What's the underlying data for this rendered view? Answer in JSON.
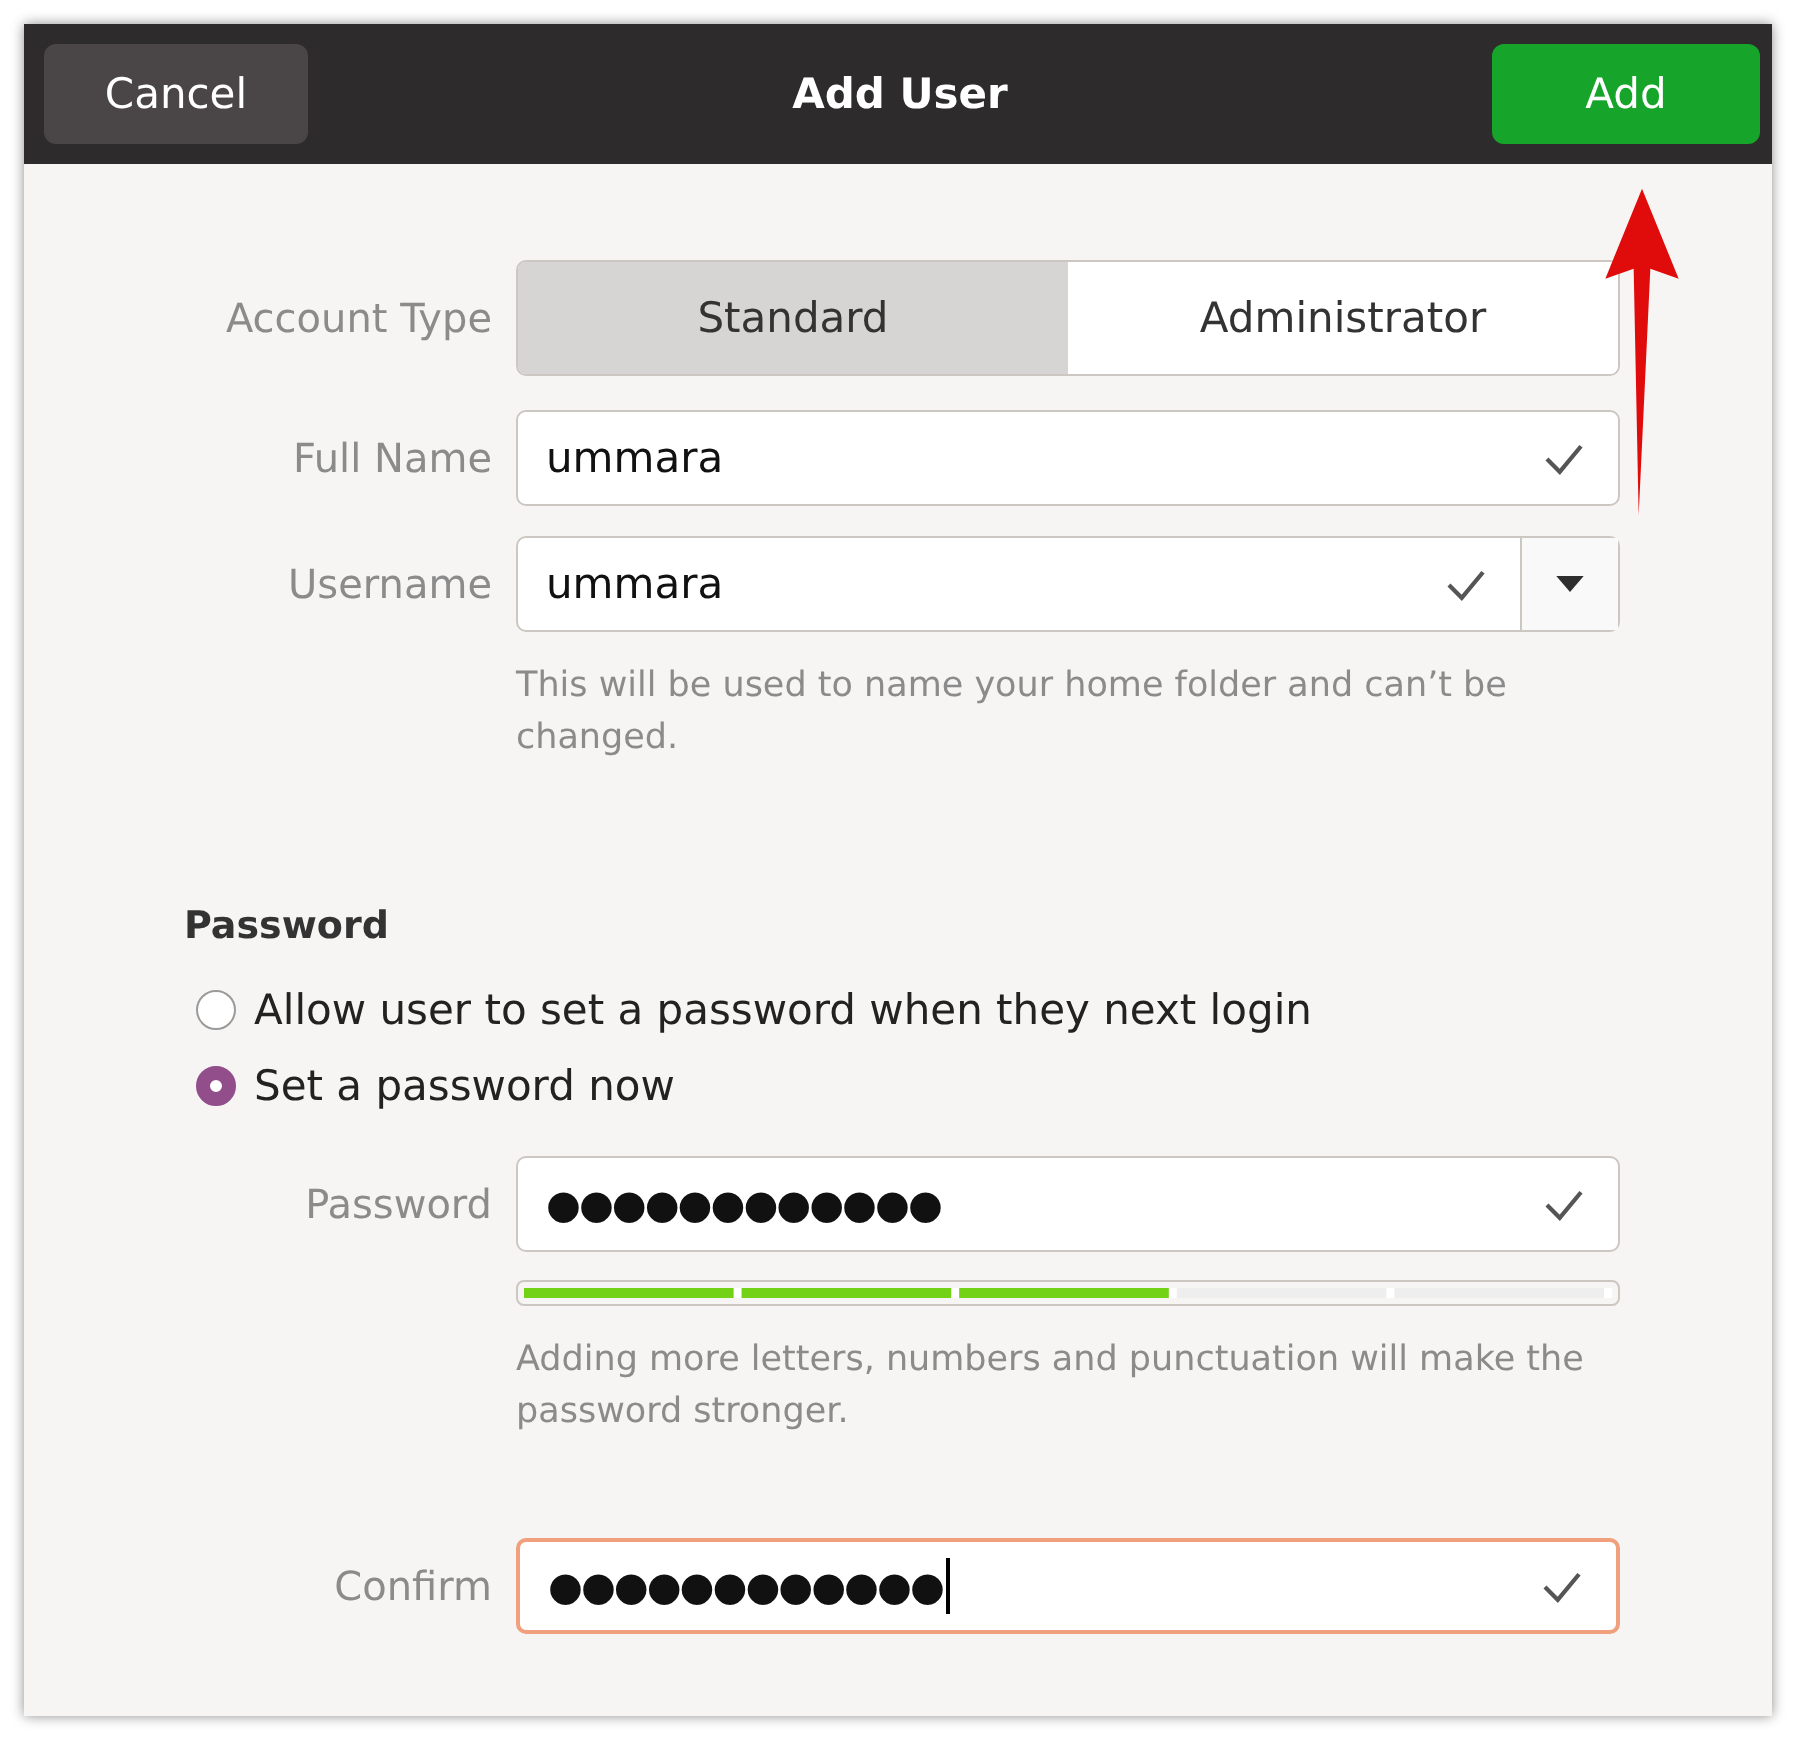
{
  "header": {
    "cancel": "Cancel",
    "title": "Add User",
    "add": "Add"
  },
  "account_type": {
    "label": "Account Type",
    "options": [
      {
        "label": "Standard",
        "selected": true
      },
      {
        "label": "Administrator",
        "selected": false
      }
    ]
  },
  "full_name": {
    "label": "Full Name",
    "value": "ummara",
    "valid": true
  },
  "username": {
    "label": "Username",
    "value": "ummara",
    "valid": true,
    "hint": "This will be used to name your home folder and can’t be changed."
  },
  "password_section": {
    "heading": "Password",
    "options": [
      {
        "label": "Allow user to set a password when they next login",
        "selected": false
      },
      {
        "label": "Set a password now",
        "selected": true
      }
    ]
  },
  "password": {
    "label": "Password",
    "value": "●●●●●●●●●●●●",
    "valid": true,
    "focused": false
  },
  "strength": {
    "level": 0.6,
    "hint": "Adding more letters, numbers and punctuation will make the password stronger."
  },
  "confirm": {
    "label": "Confirm",
    "value": "●●●●●●●●●●●●",
    "valid": true,
    "focused": true
  }
}
